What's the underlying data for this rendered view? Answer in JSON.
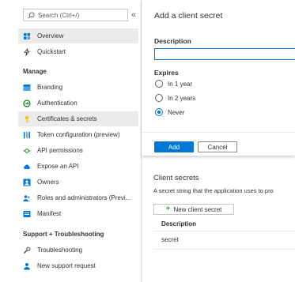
{
  "search": {
    "placeholder": "Search (Ctrl+/)",
    "collapse_glyph": "«"
  },
  "sidebar": {
    "items_top": [
      {
        "label": "Overview",
        "icon": "overview-icon",
        "selected": true
      },
      {
        "label": "Quickstart",
        "icon": "quickstart-icon"
      }
    ],
    "manage_label": "Manage",
    "manage_items": [
      {
        "label": "Branding",
        "icon": "branding-icon"
      },
      {
        "label": "Authentication",
        "icon": "authentication-icon"
      },
      {
        "label": "Certificates & secrets",
        "icon": "key-icon"
      },
      {
        "label": "Token configuration (preview)",
        "icon": "token-config-icon"
      },
      {
        "label": "API permissions",
        "icon": "api-permissions-icon"
      },
      {
        "label": "Expose an API",
        "icon": "cloud-icon"
      },
      {
        "label": "Owners",
        "icon": "owners-icon"
      },
      {
        "label": "Roles and administrators (Previ...",
        "icon": "roles-icon"
      },
      {
        "label": "Manifest",
        "icon": "manifest-icon"
      }
    ],
    "support_label": "Support + Troubleshooting",
    "support_items": [
      {
        "label": "Troubleshooting",
        "icon": "wrench-icon"
      },
      {
        "label": "New support request",
        "icon": "support-request-icon"
      }
    ]
  },
  "panel": {
    "title": "Add a client secret",
    "description_label": "Description",
    "description_value": "",
    "expires_label": "Expires",
    "expires_options": [
      "In 1 year",
      "In 2 years",
      "Never"
    ],
    "expires_selected": "Never",
    "add_label": "Add",
    "cancel_label": "Cancel"
  },
  "background": {
    "heading": "Client secrets",
    "text": "A secret string that the application uses to pro",
    "new_button": "New client secret",
    "column_header": "Description",
    "row_value": "secret"
  },
  "colors": {
    "accent": "#0078d4",
    "selected_bg": "#edebe9",
    "add_green": "#107c10"
  }
}
